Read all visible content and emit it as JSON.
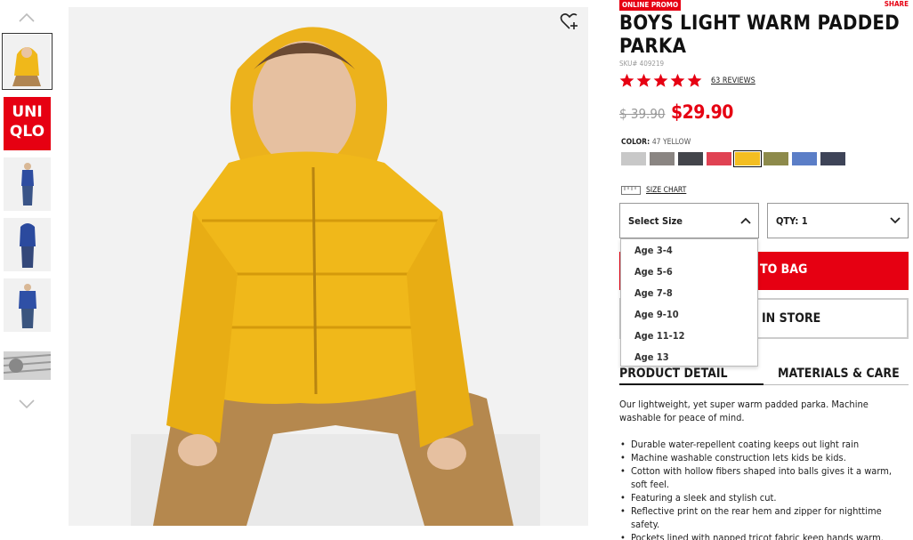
{
  "product": {
    "promo_badge": "ONLINE PROMO",
    "share_label": "SHARE",
    "title": "BOYS LIGHT WARM PADDED PARKA",
    "sku": "SKU# 409219",
    "rating_stars": 5,
    "reviews_label": "63 REVIEWS",
    "old_price": "$ 39.90",
    "new_price": "$29.90"
  },
  "color": {
    "label": "COLOR:",
    "selected_name": "47 YELLOW",
    "swatches": [
      "#c8c8c8",
      "#8a8582",
      "#43454b",
      "#e04253",
      "#f4be21",
      "#8d8a4b",
      "#5b7ec7",
      "#3e4458"
    ],
    "selected_index": 4
  },
  "size_chart": {
    "label": "SIZE CHART"
  },
  "size_select": {
    "label": "Select Size",
    "options": [
      "Age 3-4",
      "Age 5-6",
      "Age 7-8",
      "Age 9-10",
      "Age 11-12",
      "Age 13"
    ]
  },
  "qty_select": {
    "label": "QTY: 1"
  },
  "buttons": {
    "add_to_bag": "TO BAG",
    "find_in_store": "IN STORE"
  },
  "tabs": {
    "product_detail": "PRODUCT DETAIL",
    "materials_care": "MATERIALS & CARE"
  },
  "description": {
    "intro": "Our lightweight, yet super warm padded parka. Machine washable for peace of mind.",
    "bullets": [
      "Durable water-repellent coating keeps out light rain",
      "Machine washable construction lets kids be kids.",
      "Cotton with hollow fibers shaped into balls gives it a warm, soft feel.",
      "Featuring a sleek and stylish cut.",
      "Reflective print on the rear hem and zipper for nighttime safety.",
      "Pockets lined with napped tricot fabric keep hands warm."
    ]
  },
  "thumbnails": {
    "logo_text_1": "UNI",
    "logo_text_2": "QLO"
  },
  "colors": {
    "brand_red": "#e60012",
    "jacket_yellow": "#f0b81a"
  }
}
